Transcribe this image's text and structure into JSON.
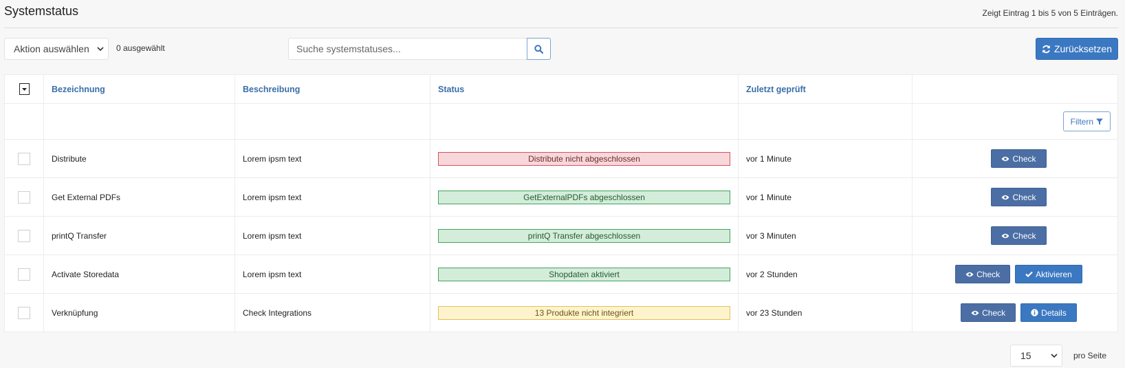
{
  "header": {
    "title": "Systemstatus",
    "info": "Zeigt Eintrag 1 bis 5 von 5 Einträgen."
  },
  "toolbar": {
    "action_select": "Aktion auswählen",
    "selected_count": "0 ausgewählt",
    "search_placeholder": "Suche systemstatuses...",
    "reset_label": "Zurücksetzen"
  },
  "table": {
    "columns": [
      "Bezeichnung",
      "Beschreibung",
      "Status",
      "Zuletzt geprüft"
    ],
    "filter_label": "Filtern",
    "rows": [
      {
        "name": "Distribute",
        "description": "Lorem ipsm text",
        "status": "Distribute nicht abgeschlossen",
        "status_color": "red",
        "checked": "vor 1 Minute",
        "actions": [
          "Check"
        ]
      },
      {
        "name": "Get External PDFs",
        "description": "Lorem ipsm text",
        "status": "GetExternalPDFs abgeschlossen",
        "status_color": "green",
        "checked": "vor 1 Minute",
        "actions": [
          "Check"
        ]
      },
      {
        "name": "printQ Transfer",
        "description": "Lorem ipsm text",
        "status": "printQ Transfer abgeschlossen",
        "status_color": "green",
        "checked": "vor 3 Minuten",
        "actions": [
          "Check"
        ]
      },
      {
        "name": "Activate Storedata",
        "description": "Lorem ipsm text",
        "status": "Shopdaten aktiviert",
        "status_color": "green",
        "checked": "vor 2 Stunden",
        "actions": [
          "Check",
          "Aktivieren"
        ]
      },
      {
        "name": "Verknüpfung",
        "description": "Check Integrations",
        "status": "13 Produkte nicht integriert",
        "status_color": "yellow",
        "checked": "vor 23 Stunden",
        "actions": [
          "Check",
          "Details"
        ]
      }
    ]
  },
  "pagination": {
    "per_page": "15",
    "per_page_label": "pro Seite"
  },
  "colors": {
    "primary": "#3b78c2",
    "check_button": "#4b6ea4",
    "header_text": "#3a6ea8"
  }
}
